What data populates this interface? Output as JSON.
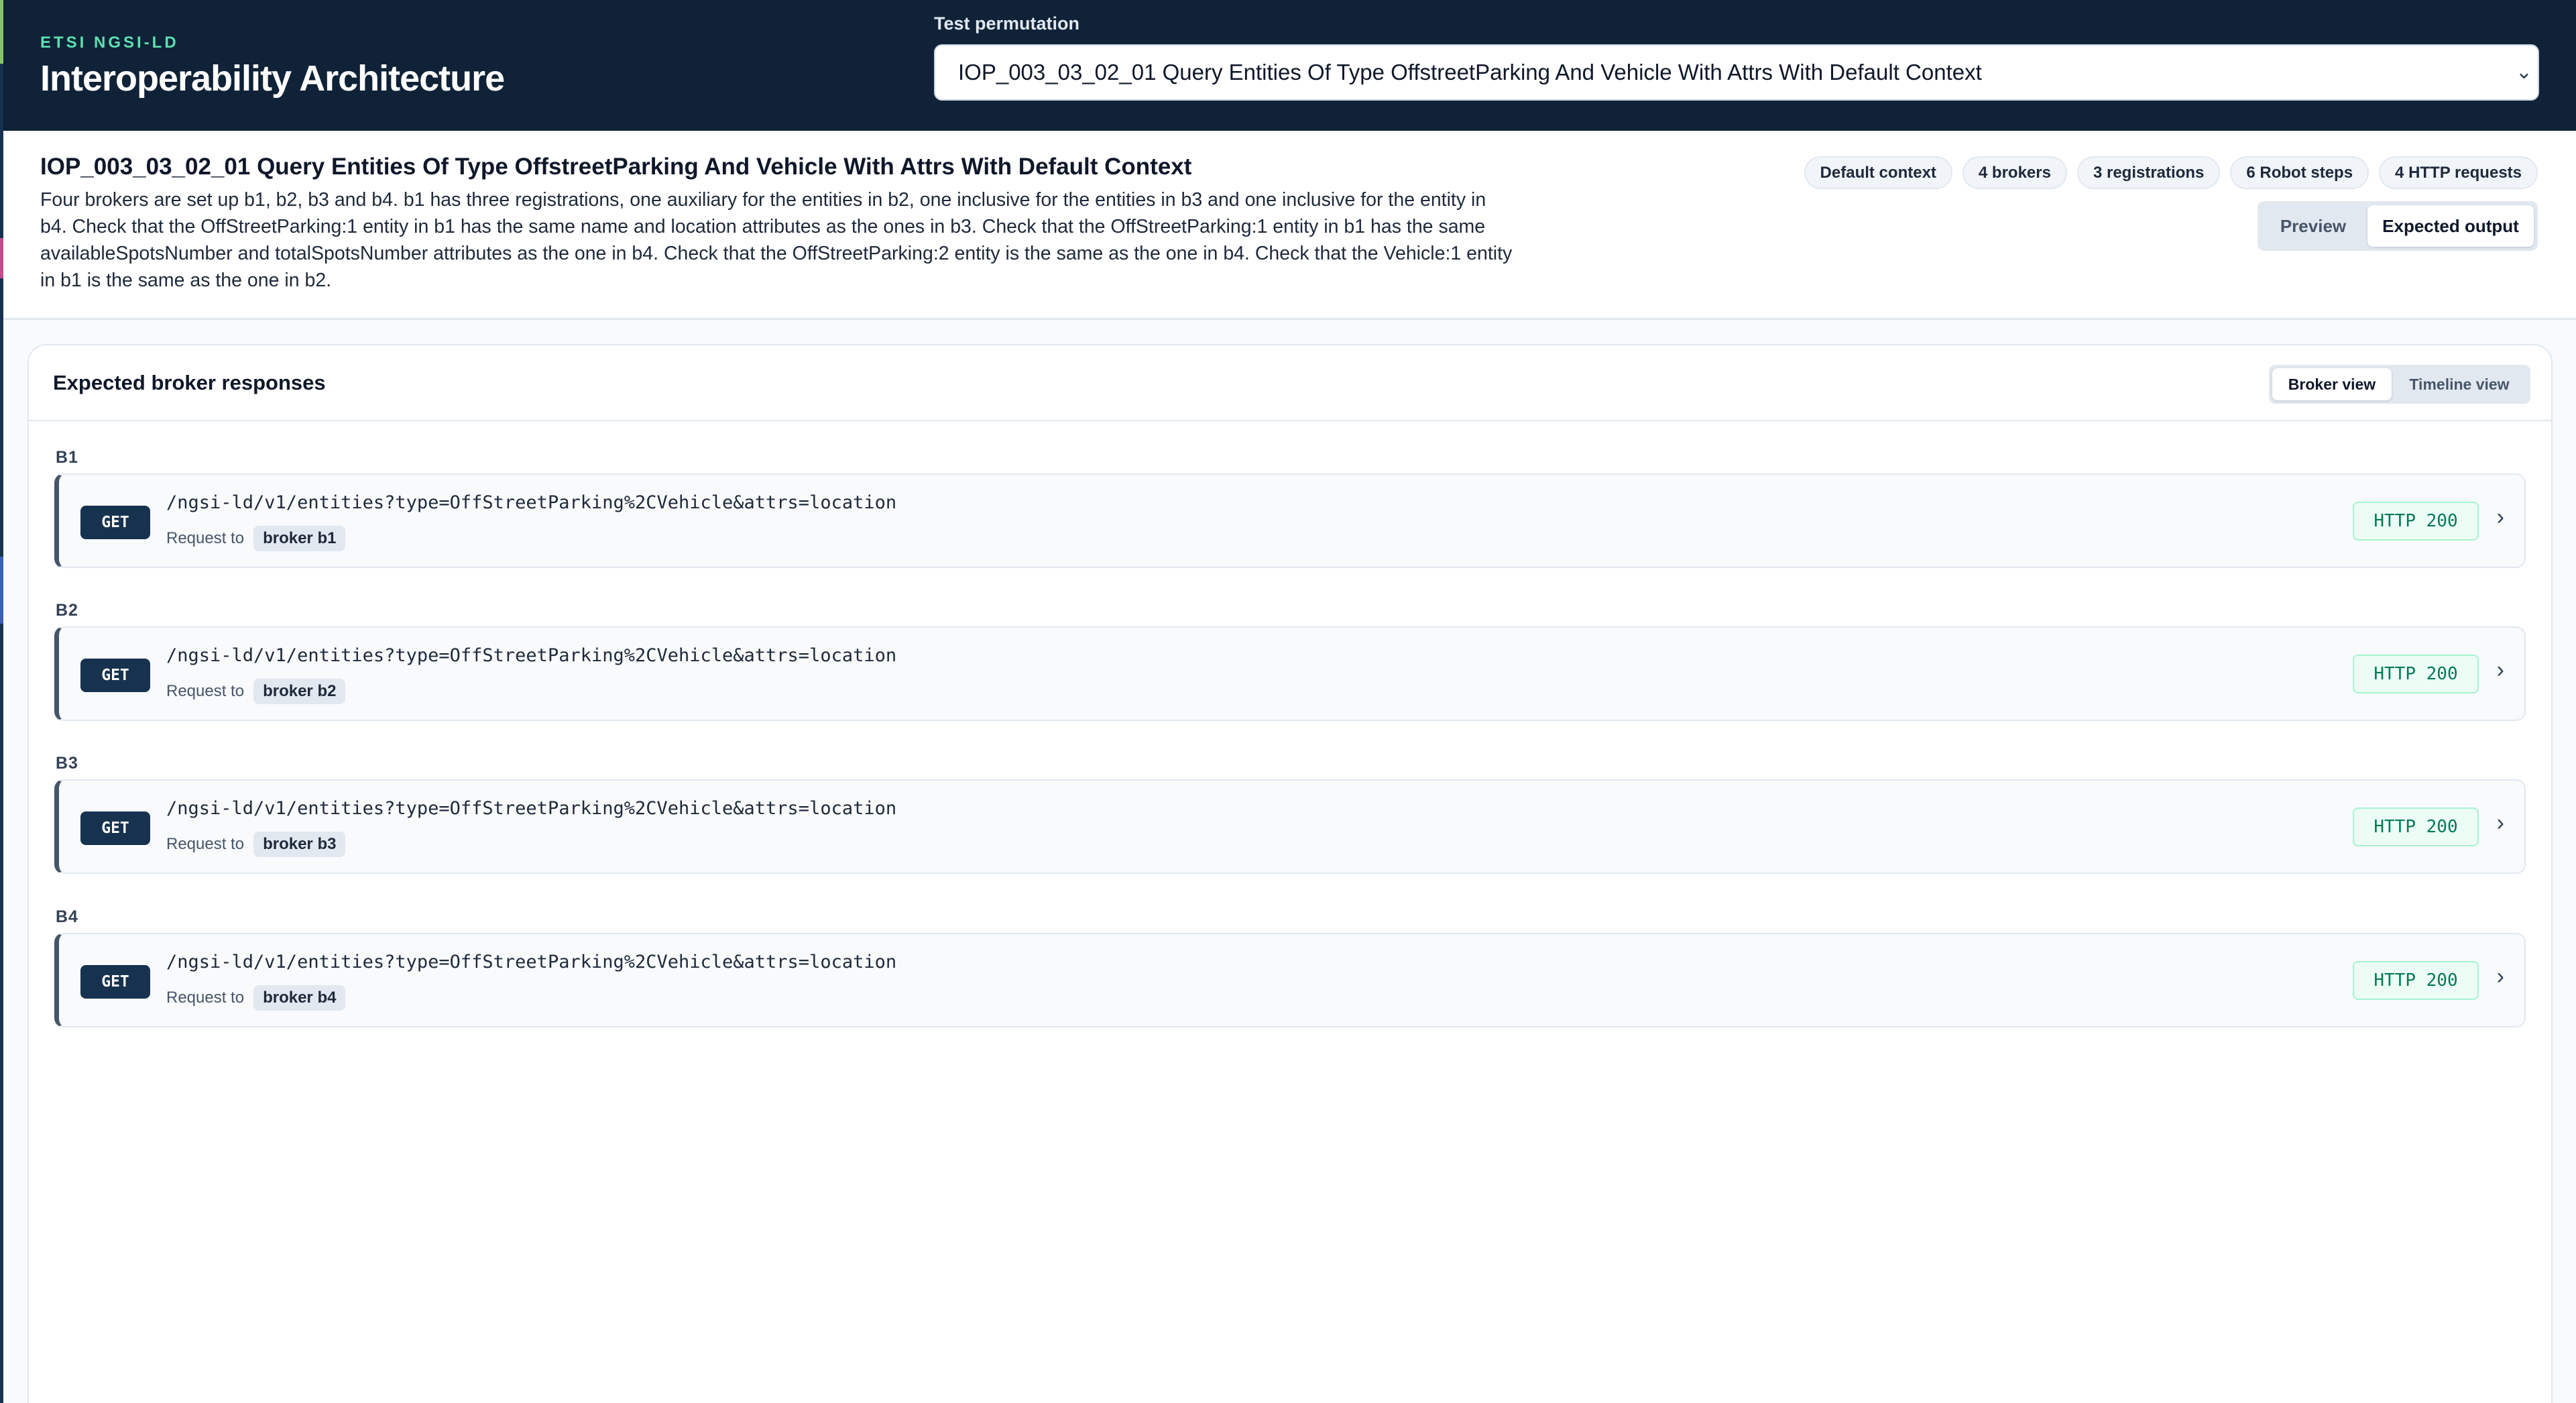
{
  "header": {
    "kicker": "ETSI NGSI-LD",
    "title": "Interoperability Architecture",
    "permutation_label": "Test permutation",
    "permutation_value": "IOP_003_03_02_01 Query Entities Of Type OffstreetParking And Vehicle With Attrs With Default Context"
  },
  "summary": {
    "title": "IOP_003_03_02_01 Query Entities Of Type OffstreetParking And Vehicle With Attrs With Default Context",
    "description": "Four brokers are set up b1, b2, b3 and b4. b1 has three registrations, one auxiliary for the entities in b2, one inclusive for the entities in b3 and one inclusive for the entity in b4. Check that the OffStreetParking:1 entity in b1 has the same name and location attributes as the ones in b3. Check that the OffStreetParking:1 entity in b1 has the same availableSpotsNumber and totalSpotsNumber attributes as the one in b4. Check that the OffStreetParking:2 entity is the same as the one in b4. Check that the Vehicle:1 entity in b1 is the same as the one in b2.",
    "badges": [
      "Default context",
      "4 brokers",
      "3 registrations",
      "6 Robot steps",
      "4 HTTP requests"
    ],
    "view_toggle": {
      "preview": "Preview",
      "expected": "Expected output",
      "active": "expected"
    }
  },
  "panel": {
    "title": "Expected broker responses",
    "view_toggle": {
      "broker": "Broker view",
      "timeline": "Timeline view",
      "active": "broker"
    },
    "request_to_label": "Request to",
    "brokers": [
      {
        "label": "B1",
        "method": "GET",
        "path": "/ngsi-ld/v1/entities?type=OffStreetParking%2CVehicle&attrs=location",
        "target": "broker b1",
        "status": "HTTP 200"
      },
      {
        "label": "B2",
        "method": "GET",
        "path": "/ngsi-ld/v1/entities?type=OffStreetParking%2CVehicle&attrs=location",
        "target": "broker b2",
        "status": "HTTP 200"
      },
      {
        "label": "B3",
        "method": "GET",
        "path": "/ngsi-ld/v1/entities?type=OffStreetParking%2CVehicle&attrs=location",
        "target": "broker b3",
        "status": "HTTP 200"
      },
      {
        "label": "B4",
        "method": "GET",
        "path": "/ngsi-ld/v1/entities?type=OffStreetParking%2CVehicle&attrs=location",
        "target": "broker b4",
        "status": "HTTP 200"
      }
    ]
  },
  "colors": {
    "header_bg": "#0f2237",
    "accent": "#5ee0b0",
    "method_bg": "#17324f",
    "status_ok": "#047857"
  },
  "icons": {
    "select_chevron": "chevron-down-icon",
    "expand": "chevron-right-icon"
  }
}
